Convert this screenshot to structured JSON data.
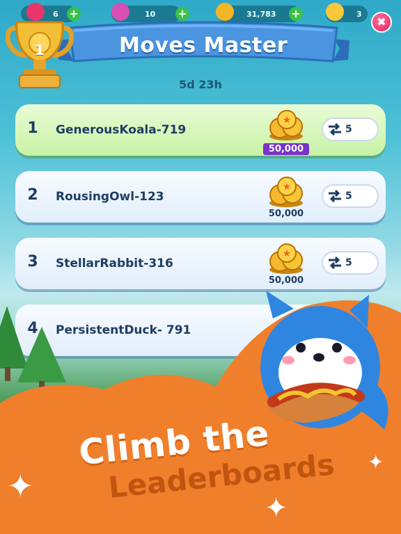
{
  "topbar": {
    "items": [
      {
        "icon": "heart-icon",
        "value": "6"
      },
      {
        "icon": "gift-icon",
        "value": "10"
      },
      {
        "icon": "coin-icon",
        "value": "31,783"
      },
      {
        "icon": "star-icon",
        "value": "3"
      }
    ]
  },
  "event": {
    "title": "Moves Master",
    "trophy_rank": "1",
    "timer": "5d 23h"
  },
  "leaderboard": [
    {
      "rank": "1",
      "name": "GenerousKoala-719",
      "reward": "50,000",
      "moves": "5",
      "highlight": true
    },
    {
      "rank": "2",
      "name": "RousingOwl-123",
      "reward": "50,000",
      "moves": "5",
      "highlight": false
    },
    {
      "rank": "3",
      "name": "StellarRabbit-316",
      "reward": "50,000",
      "moves": "5",
      "highlight": false
    },
    {
      "rank": "4",
      "name": "PersistentDuck- 791",
      "reward": "",
      "moves": "",
      "highlight": false
    }
  ],
  "promo": {
    "line1": "Climb the",
    "line2": "Leaderboards"
  },
  "colors": {
    "accent": "#f07f2c",
    "banner": "#3d86d4",
    "first_row": "#c8f2a4",
    "reward_badge": "#7a32c7"
  }
}
